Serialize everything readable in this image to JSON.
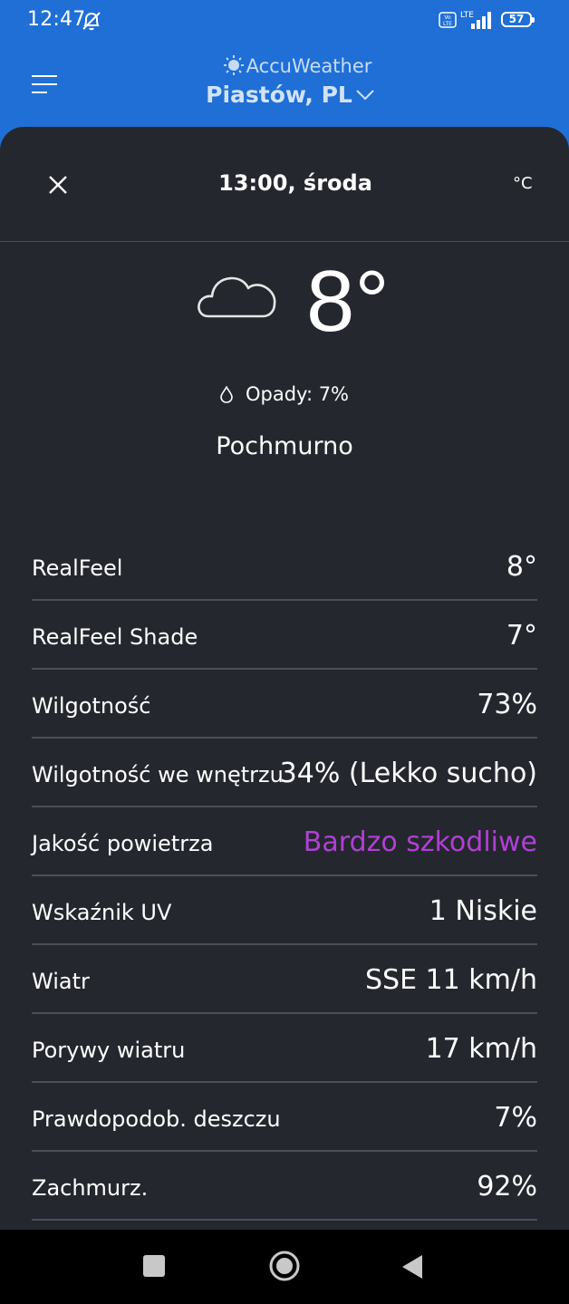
{
  "status_bar": {
    "time": "12:47",
    "battery": "57",
    "icons": [
      "bell-off-icon",
      "volte-icon",
      "lte-signal-icon",
      "battery-icon"
    ]
  },
  "header": {
    "brand": "AccuWeather",
    "location": "Piastów, PL"
  },
  "sheet": {
    "title": "13:00, środa",
    "unit": "°C",
    "temperature": "8°",
    "precip": "Opady: 7%",
    "condition": "Pochmurno"
  },
  "details": [
    {
      "label": "RealFeel",
      "value": "8°"
    },
    {
      "label": "RealFeel Shade",
      "value": "7°"
    },
    {
      "label": "Wilgotność",
      "value": "73%"
    },
    {
      "label": "Wilgotność we wnętrzu",
      "value": "34% (Lekko sucho)"
    },
    {
      "label": "Jakość powietrza",
      "value": "Bardzo szkodliwe"
    },
    {
      "label": "Wskaźnik UV",
      "value": "1 Niskie"
    },
    {
      "label": "Wiatr",
      "value": "SSE 11 km/h"
    },
    {
      "label": "Porywy wiatru",
      "value": "17 km/h"
    },
    {
      "label": "Prawdopodob. deszczu",
      "value": "7%"
    },
    {
      "label": "Zachmurz.",
      "value": "92%"
    }
  ],
  "colors": {
    "header_blue": "#1f6fd6",
    "sheet_bg": "#24272e",
    "alert_purple": "#b23fd6"
  }
}
